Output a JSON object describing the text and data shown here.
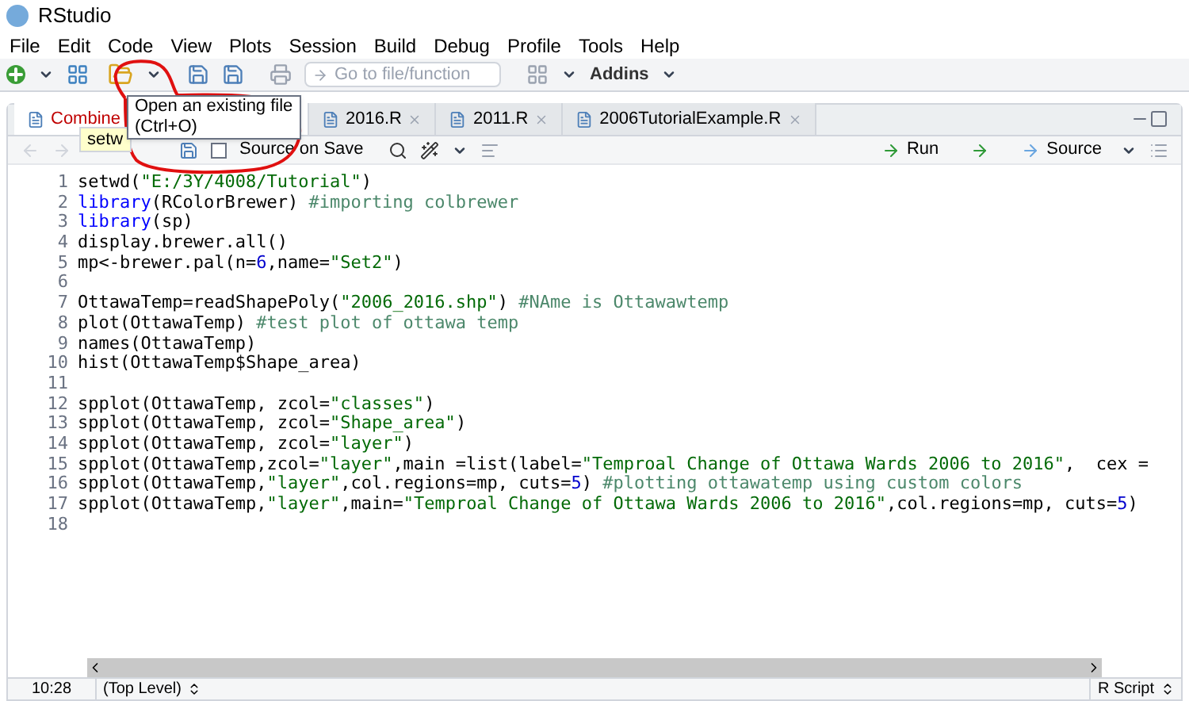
{
  "window": {
    "title": "RStudio"
  },
  "menu": [
    "File",
    "Edit",
    "Code",
    "View",
    "Plots",
    "Session",
    "Build",
    "Debug",
    "Profile",
    "Tools",
    "Help"
  ],
  "toolbar": {
    "goto_placeholder": "Go to file/function",
    "addins": "Addins"
  },
  "tooltip": {
    "line1": "Open an existing file",
    "line2": "(Ctrl+O)"
  },
  "hint": "setw",
  "tabs": [
    {
      "label": "Combine",
      "selected": true,
      "modified": true
    },
    {
      "label": "2016.R",
      "selected": false,
      "modified": false
    },
    {
      "label": "2011.R",
      "selected": false,
      "modified": false
    },
    {
      "label": "2006TutorialExample.R",
      "selected": false,
      "modified": false
    }
  ],
  "editor_toolbar": {
    "source_on_save": "Source on Save",
    "source_on_save_checked": false,
    "run": "Run",
    "source": "Source"
  },
  "code": [
    {
      "number": "1",
      "tokens": [
        {
          "text": "setwd(",
          "kind": "plain"
        },
        {
          "text": "\"E:/3Y/4008/Tutorial\"",
          "kind": "string"
        },
        {
          "text": ")",
          "kind": "plain"
        }
      ]
    },
    {
      "number": "2",
      "tokens": [
        {
          "text": "library",
          "kind": "keyword"
        },
        {
          "text": "(RColorBrewer) ",
          "kind": "plain"
        },
        {
          "text": "#importing colbrewer",
          "kind": "comment"
        }
      ]
    },
    {
      "number": "3",
      "tokens": [
        {
          "text": "library",
          "kind": "keyword"
        },
        {
          "text": "(sp)",
          "kind": "plain"
        }
      ]
    },
    {
      "number": "4",
      "tokens": [
        {
          "text": "display.brewer.all()",
          "kind": "plain"
        }
      ]
    },
    {
      "number": "5",
      "tokens": [
        {
          "text": "mp<-brewer.pal(n=",
          "kind": "plain"
        },
        {
          "text": "6",
          "kind": "number"
        },
        {
          "text": ",name=",
          "kind": "plain"
        },
        {
          "text": "\"Set2\"",
          "kind": "string"
        },
        {
          "text": ")",
          "kind": "plain"
        }
      ]
    },
    {
      "number": "6"
    },
    {
      "number": "7",
      "tokens": [
        {
          "text": "OttawaTemp=readShapePoly(",
          "kind": "plain"
        },
        {
          "text": "\"2006_2016.shp\"",
          "kind": "string"
        },
        {
          "text": ") ",
          "kind": "plain"
        },
        {
          "text": "#NAme is Ottawawtemp",
          "kind": "comment"
        }
      ]
    },
    {
      "number": "8",
      "tokens": [
        {
          "text": "plot(OttawaTemp) ",
          "kind": "plain"
        },
        {
          "text": "#test plot of ottawa temp",
          "kind": "comment"
        }
      ]
    },
    {
      "number": "9",
      "tokens": [
        {
          "text": "names(OttawaTemp)",
          "kind": "plain"
        }
      ]
    },
    {
      "number": "10",
      "tokens": [
        {
          "text": "hist(OttawaTemp$Shape_area)",
          "kind": "plain"
        }
      ]
    },
    {
      "number": "11"
    },
    {
      "number": "12",
      "tokens": [
        {
          "text": "spplot(OttawaTemp, zcol=",
          "kind": "plain"
        },
        {
          "text": "\"classes\"",
          "kind": "string"
        },
        {
          "text": ")",
          "kind": "plain"
        }
      ]
    },
    {
      "number": "13",
      "tokens": [
        {
          "text": "spplot(OttawaTemp, zcol=",
          "kind": "plain"
        },
        {
          "text": "\"Shape_area\"",
          "kind": "string"
        },
        {
          "text": ")",
          "kind": "plain"
        }
      ]
    },
    {
      "number": "14",
      "tokens": [
        {
          "text": "spplot(OttawaTemp, zcol=",
          "kind": "plain"
        },
        {
          "text": "\"layer\"",
          "kind": "string"
        },
        {
          "text": ")",
          "kind": "plain"
        }
      ]
    },
    {
      "number": "15",
      "tokens": [
        {
          "text": "spplot(OttawaTemp,zcol=",
          "kind": "plain"
        },
        {
          "text": "\"layer\"",
          "kind": "string"
        },
        {
          "text": ",main =list(label=",
          "kind": "plain"
        },
        {
          "text": "\"Temproal Change of Ottawa Wards 2006 to 2016\"",
          "kind": "string"
        },
        {
          "text": ",  cex =",
          "kind": "plain"
        }
      ]
    },
    {
      "number": "16",
      "tokens": [
        {
          "text": "spplot(OttawaTemp,",
          "kind": "plain"
        },
        {
          "text": "\"layer\"",
          "kind": "string"
        },
        {
          "text": ",col.regions=mp, cuts=",
          "kind": "plain"
        },
        {
          "text": "5",
          "kind": "number"
        },
        {
          "text": ") ",
          "kind": "plain"
        },
        {
          "text": "#plotting ottawatemp using custom colors",
          "kind": "comment"
        }
      ]
    },
    {
      "number": "17",
      "tokens": [
        {
          "text": "spplot(OttawaTemp,",
          "kind": "plain"
        },
        {
          "text": "\"layer\"",
          "kind": "string"
        },
        {
          "text": ",main=",
          "kind": "plain"
        },
        {
          "text": "\"Temproal Change of Ottawa Wards 2006 to 2016\"",
          "kind": "string"
        },
        {
          "text": ",col.regions=mp, cuts=",
          "kind": "plain"
        },
        {
          "text": "5",
          "kind": "number"
        },
        {
          "text": ")",
          "kind": "plain"
        }
      ]
    },
    {
      "number": "18"
    }
  ],
  "status_bar": {
    "position": "10:28",
    "scope": "(Top Level)",
    "file_type": "R Script"
  }
}
